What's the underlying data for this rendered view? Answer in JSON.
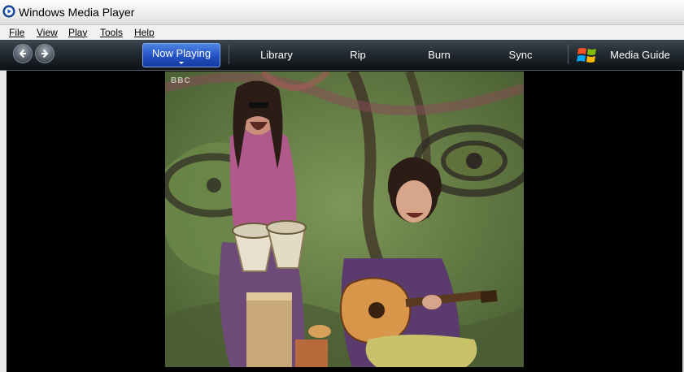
{
  "window": {
    "title": "Windows Media Player",
    "icon": "media-player-icon"
  },
  "menu": {
    "items": [
      {
        "label": "File"
      },
      {
        "label": "View"
      },
      {
        "label": "Play"
      },
      {
        "label": "Tools"
      },
      {
        "label": "Help"
      }
    ]
  },
  "nav": {
    "back_icon": "back-arrow-icon",
    "forward_icon": "forward-arrow-icon"
  },
  "tabs": {
    "now_playing": "Now Playing",
    "library": "Library",
    "rip": "Rip",
    "burn": "Burn",
    "sync": "Sync",
    "media_guide": "Media Guide",
    "active": "Now Playing"
  },
  "video": {
    "channel_logo": "BBC"
  },
  "colors": {
    "active_tab": "#2554c7",
    "taskbar": "#1b2028",
    "video_background": "#000000"
  }
}
